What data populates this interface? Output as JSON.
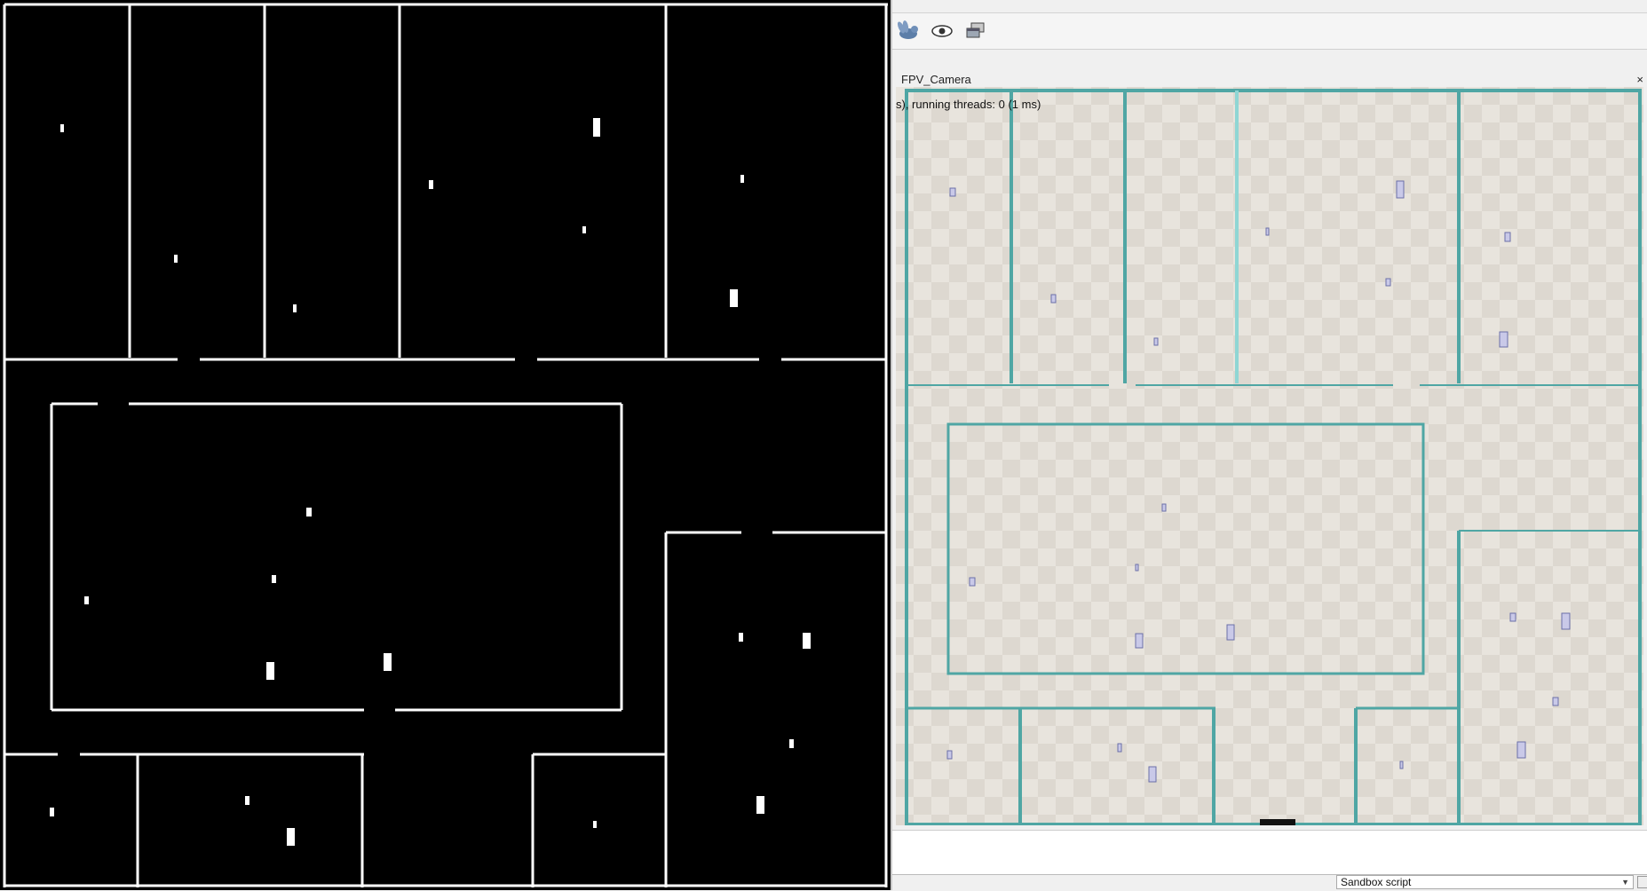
{
  "left_view": {
    "name": "occupancy-map",
    "background": "#000000",
    "line_color": "#ffffff"
  },
  "toolbar": {
    "buttons": [
      {
        "icon": "rabbit-icon",
        "label": ""
      },
      {
        "icon": "eye-icon",
        "label": ""
      },
      {
        "icon": "windows-icon",
        "label": ""
      }
    ]
  },
  "camera_view": {
    "title": "FPV_Camera",
    "close_glyph": "×",
    "status": "s), running threads: 0 (1 ms)",
    "wall_color": "#4fa6a4",
    "floor_color": "#ddd8d0"
  },
  "bottom": {
    "script_select_value": "Sandbox script"
  }
}
